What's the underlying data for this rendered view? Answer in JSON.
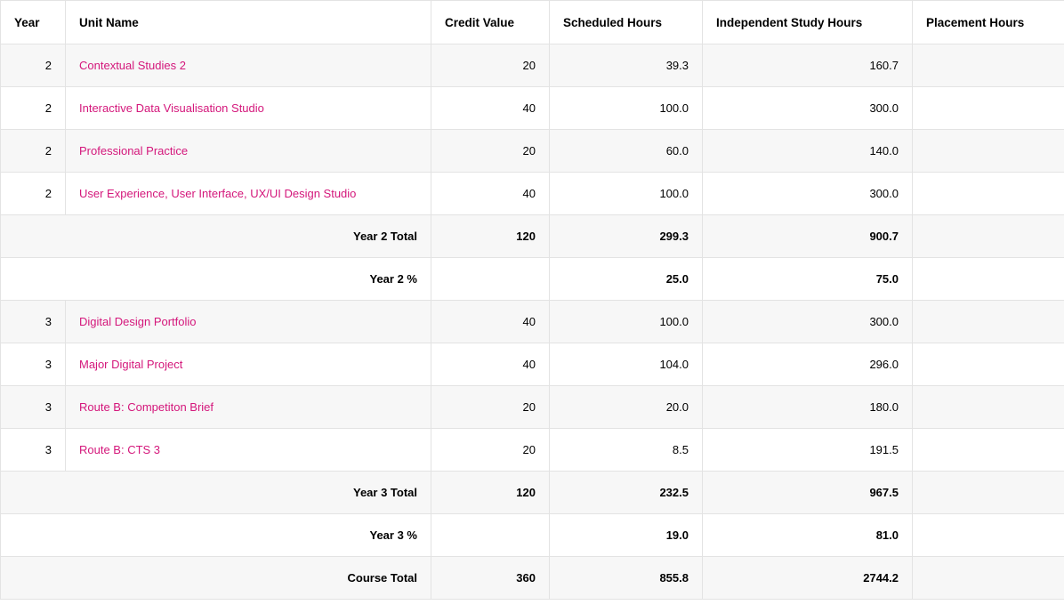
{
  "headers": {
    "year": "Year",
    "unit_name": "Unit Name",
    "credit_value": "Credit Value",
    "scheduled_hours": "Scheduled Hours",
    "independent_study_hours": "Independent Study Hours",
    "placement_hours": "Placement Hours"
  },
  "rows": [
    {
      "year": "2",
      "unit": "Contextual Studies 2",
      "credit": "20",
      "scheduled": "39.3",
      "independent": "160.7",
      "placement": ""
    },
    {
      "year": "2",
      "unit": "Interactive Data Visualisation Studio",
      "credit": "40",
      "scheduled": "100.0",
      "independent": "300.0",
      "placement": ""
    },
    {
      "year": "2",
      "unit": "Professional Practice",
      "credit": "20",
      "scheduled": "60.0",
      "independent": "140.0",
      "placement": ""
    },
    {
      "year": "2",
      "unit": "User Experience, User Interface, UX/UI Design Studio",
      "credit": "40",
      "scheduled": "100.0",
      "independent": "300.0",
      "placement": ""
    },
    {
      "label": "Year 2 Total",
      "credit": "120",
      "scheduled": "299.3",
      "independent": "900.7",
      "placement": ""
    },
    {
      "label": "Year 2 %",
      "credit": "",
      "scheduled": "25.0",
      "independent": "75.0",
      "placement": ""
    },
    {
      "year": "3",
      "unit": "Digital Design Portfolio",
      "credit": "40",
      "scheduled": "100.0",
      "independent": "300.0",
      "placement": ""
    },
    {
      "year": "3",
      "unit": "Major Digital Project",
      "credit": "40",
      "scheduled": "104.0",
      "independent": "296.0",
      "placement": ""
    },
    {
      "year": "3",
      "unit": "Route B: Competiton Brief",
      "credit": "20",
      "scheduled": "20.0",
      "independent": "180.0",
      "placement": ""
    },
    {
      "year": "3",
      "unit": "Route B: CTS 3",
      "credit": "20",
      "scheduled": "8.5",
      "independent": "191.5",
      "placement": ""
    },
    {
      "label": "Year 3 Total",
      "credit": "120",
      "scheduled": "232.5",
      "independent": "967.5",
      "placement": ""
    },
    {
      "label": "Year 3 %",
      "credit": "",
      "scheduled": "19.0",
      "independent": "81.0",
      "placement": ""
    },
    {
      "label": "Course Total",
      "credit": "360",
      "scheduled": "855.8",
      "independent": "2744.2",
      "placement": ""
    }
  ],
  "colors": {
    "link": "#d4177b",
    "stripe": "#f7f7f7",
    "border": "#e3e3e3"
  }
}
